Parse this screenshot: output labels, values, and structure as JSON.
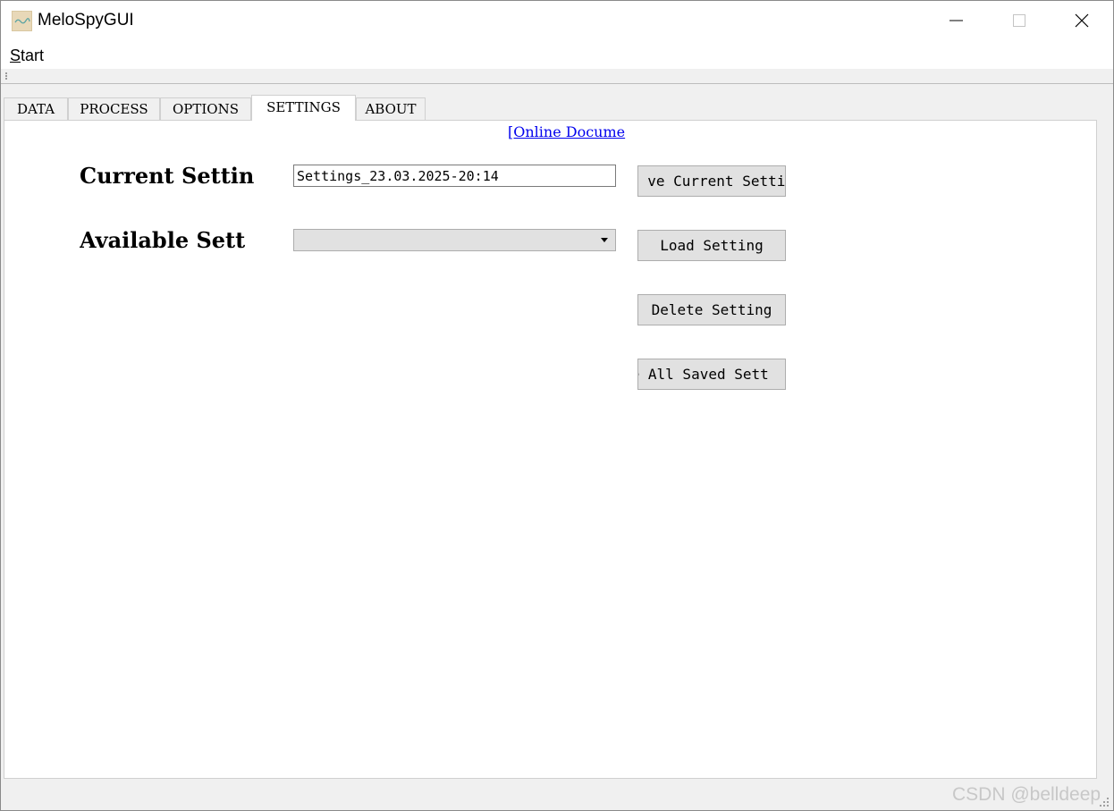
{
  "window": {
    "title": "MeloSpyGUI",
    "icon": "melospy-app-icon"
  },
  "menu": {
    "start": "Start"
  },
  "tabs": [
    {
      "label": "DATA"
    },
    {
      "label": "PROCESS"
    },
    {
      "label": "OPTIONS"
    },
    {
      "label": "SETTINGS"
    },
    {
      "label": "ABOUT"
    }
  ],
  "active_tab": "SETTINGS",
  "settings": {
    "doc_link": "[Online Docume",
    "current_label": "Current Settin",
    "current_value": "Settings_23.03.2025-20:14",
    "available_label": "Available Sett",
    "available_value": "",
    "buttons": {
      "save": "ve Current Settin",
      "load": "Load Setting",
      "delete": "Delete Setting",
      "delete_all": "te All Saved Sett"
    }
  },
  "watermark": "CSDN @belldeep",
  "colors": {
    "link": "#0000ee",
    "button_bg": "#e1e1e1",
    "window_bg": "#f0f0f0"
  }
}
